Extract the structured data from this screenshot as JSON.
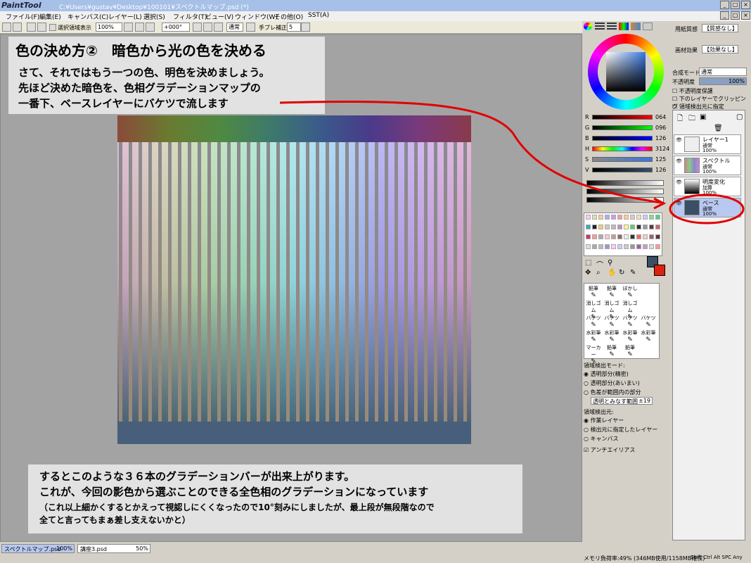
{
  "app": {
    "logo": "PaintTool SAI",
    "path": "C:¥Users¥gustav¥Desktop¥100101¥スペクトルマップ.psd (*)"
  },
  "menu": [
    "ファイル(F)",
    "編集(E)",
    "キャンバス(C)",
    "レイヤー(L)",
    "選択(S)",
    "フィルタ(T)",
    "ビュー(V)",
    "ウィンドウ(W)",
    "その他(O)",
    "SST(A)"
  ],
  "toolbar": {
    "selection_label": "選択領域表示",
    "zoom": "100%",
    "angle": "+000°",
    "mode": "通常",
    "stabilizer_label": "手ブレ補正",
    "stabilizer": "5"
  },
  "note1": {
    "heading": "色の決め方②　暗色から光の色を決める",
    "line1": "さて、それではもう一つの色、明色を決めましょう。",
    "line2": "先ほど決めた暗色を、色相グラデーションマップの",
    "line3": "一番下、ベースレイヤーにバケツで流します"
  },
  "note2": {
    "line1": "するとこのような３６本のグラデーションバーが出来上がります。",
    "line2": "これが、今回の影色から選ぶことのできる全色相のグラデーションになっています",
    "line3": "（これ以上細かくするとかえって視認しにくくなったので10°刻みにしましたが、最上段が無段階なので",
    "line4": "全てと言ってもまぁ差し支えないかと）"
  },
  "sliders": [
    {
      "k": "R",
      "v": "064"
    },
    {
      "k": "G",
      "v": "096"
    },
    {
      "k": "B",
      "v": "126"
    },
    {
      "k": "H",
      "v": "3124"
    },
    {
      "k": "S",
      "v": "125"
    },
    {
      "k": "V",
      "v": "126"
    }
  ],
  "tools": [
    [
      "鉛筆",
      "鉛筆",
      "ぼかし"
    ],
    [
      "消しゴム",
      "消しゴム",
      "消しゴム"
    ],
    [
      "バケツ",
      "バケツ",
      "バケツ",
      "バケツ"
    ],
    [
      "水彩筆",
      "水彩筆",
      "水彩筆",
      "水彩筆"
    ],
    [
      "マーカー",
      "鉛筆",
      "鉛筆"
    ]
  ],
  "bucket": {
    "mode_label": "領域検出モード:",
    "opt1": "透明部分(精密)",
    "opt2": "透明部分(あいまい)",
    "opt3": "色差が範囲内の部分",
    "range_label": "透明とみなす範囲",
    "range": "±19",
    "src_label": "領域検出元:",
    "src1": "作業レイヤー",
    "src2": "検出元に指定したレイヤー",
    "src3": "キャンバス",
    "aa": "アンチエイリアス"
  },
  "right": {
    "paper_label": "用紙質感",
    "paper": "【質感なし】",
    "effect_label": "画材効果",
    "effect": "【効果なし】",
    "blend_label": "合成モード",
    "blend": "通常",
    "opacity_label": "不透明度",
    "opacity": "100%",
    "chk1": "不透明度保護",
    "chk2": "下のレイヤーでクリッピング",
    "chk3": "領域検出元に指定"
  },
  "layers": [
    {
      "name": "レイヤー1",
      "mode": "通常",
      "op": "100%"
    },
    {
      "name": "スペクトル",
      "mode": "通常",
      "op": "100%"
    },
    {
      "name": "明度変化",
      "mode": "加算",
      "op": "100%"
    },
    {
      "name": "ベース",
      "mode": "通常",
      "op": "100%"
    }
  ],
  "status": {
    "tab1": "スペクトルマップ.psd",
    "tab1z": "100%",
    "tab2": "講座3.psd",
    "tab2z": "50%",
    "mem": "メモリ負荷率:49% (346MB使用/1158MB確保)",
    "keys": "Shift Ctrl Alt SPC Any"
  },
  "colors": {
    "accent": "#3a4f66",
    "red": "#e00000"
  }
}
